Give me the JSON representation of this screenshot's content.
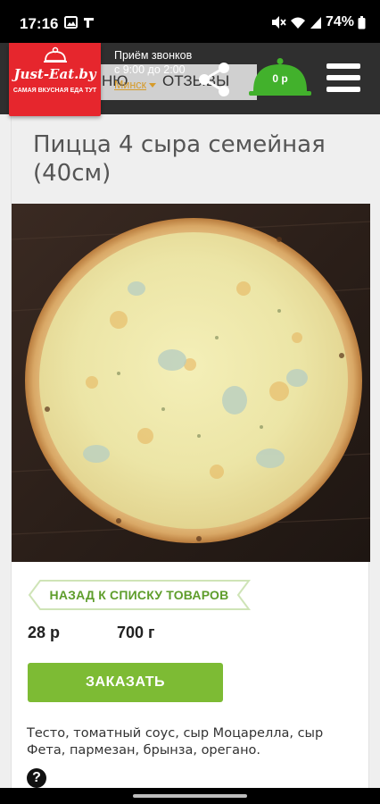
{
  "status_bar": {
    "time": "17:16",
    "battery": "74%",
    "icons": [
      "image-icon",
      "signal-app-icon",
      "mute-icon",
      "wifi-icon",
      "cell-signal-icon",
      "battery-icon"
    ]
  },
  "header": {
    "behind_nav_left": "НЮ",
    "behind_nav_right": "ОТЗЫВЫ",
    "logo_title": "Just-Eat.by",
    "logo_subtitle": "САМАЯ ВКУСНАЯ ЕДА ТУТ",
    "phone_line1": "Приём звонков",
    "phone_line2": "с 9:00 до 2:00",
    "city": "Минск",
    "cart_total": "0 р",
    "colors": {
      "logo_red": "#e6262d",
      "cart_green": "#42b12c",
      "city_gold": "#d69b2a"
    }
  },
  "product": {
    "title": "Пицца 4 сыра семейная (40см)",
    "back_label": "НАЗАД К СПИСКУ ТОВАРОВ",
    "price": "28 р",
    "weight": "700 г",
    "order_label": "ЗАКАЗАТЬ",
    "description": "Тесто, томатный соус, сыр Моцарелла, сыр Фета, пармезан, брынза, орегано.",
    "help_symbol": "?",
    "colors": {
      "accent_green": "#7dbb34",
      "back_text": "#5e9d2b"
    }
  }
}
